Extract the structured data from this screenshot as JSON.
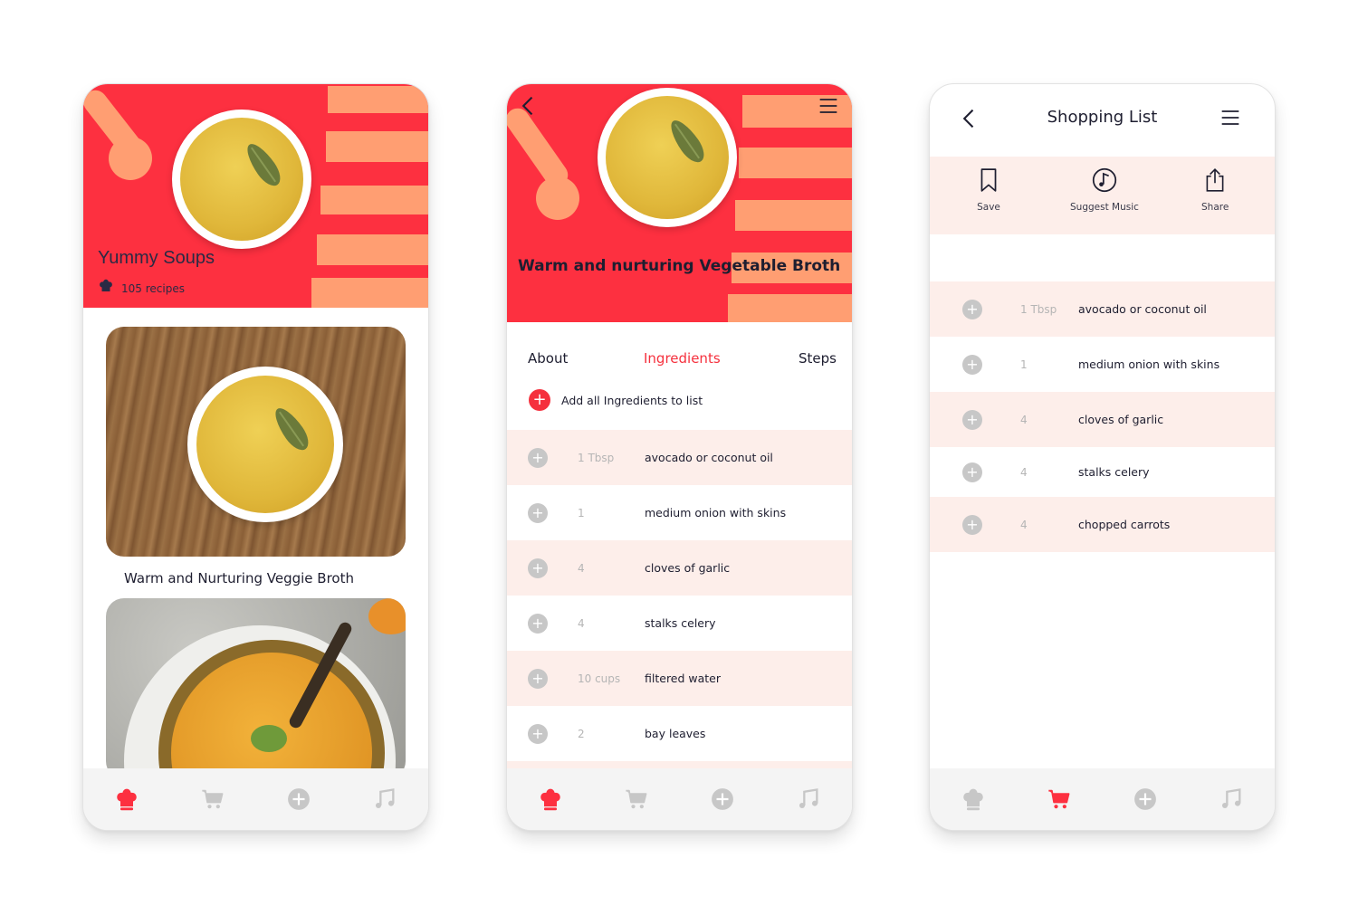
{
  "colors": {
    "primary": "#fd3040",
    "accent": "#ff9e72",
    "row_highlight": "#fdeeea",
    "tabbar": "#f4f4f4",
    "inactive_icon": "#c7c7c7"
  },
  "screen1": {
    "category_title": "Yummy Soups",
    "recipe_count": "105 recipes",
    "recipes": [
      {
        "title": "Warm and Nurturing Veggie Broth"
      },
      {
        "title": ""
      }
    ],
    "tabbar": {
      "active": "recipes",
      "icons": [
        "chef-hat-icon",
        "cart-icon",
        "add-circle-icon",
        "music-note-icon"
      ]
    }
  },
  "screen2": {
    "recipe_title": "Warm and nurturing Vegetable Broth",
    "tabs": [
      {
        "label": "About",
        "active": false
      },
      {
        "label": "Ingredients",
        "active": true
      },
      {
        "label": "Steps",
        "active": false
      }
    ],
    "add_all_label": "Add all Ingredients to list",
    "ingredients": [
      {
        "qty": "1 Tbsp",
        "name": "avocado or coconut oil"
      },
      {
        "qty": "1",
        "name": "medium onion with skins"
      },
      {
        "qty": "4",
        "name": "cloves of garlic"
      },
      {
        "qty": "4",
        "name": "stalks celery"
      },
      {
        "qty": "10 cups",
        "name": "filtered water"
      },
      {
        "qty": "2",
        "name": "bay leaves"
      }
    ],
    "tabbar": {
      "active": "recipes"
    }
  },
  "screen3": {
    "title": "Shopping List",
    "actions": [
      {
        "label": "Save",
        "icon": "bookmark-icon"
      },
      {
        "label": "Suggest Music",
        "icon": "music-icon"
      },
      {
        "label": "Share",
        "icon": "share-icon"
      }
    ],
    "items": [
      {
        "qty": "1 Tbsp",
        "name": "avocado or coconut oil"
      },
      {
        "qty": "1",
        "name": "medium onion with skins"
      },
      {
        "qty": "4",
        "name": "cloves of garlic"
      },
      {
        "qty": "4",
        "name": "stalks celery"
      },
      {
        "qty": "4",
        "name": "chopped carrots"
      }
    ],
    "tabbar": {
      "active": "cart"
    }
  }
}
